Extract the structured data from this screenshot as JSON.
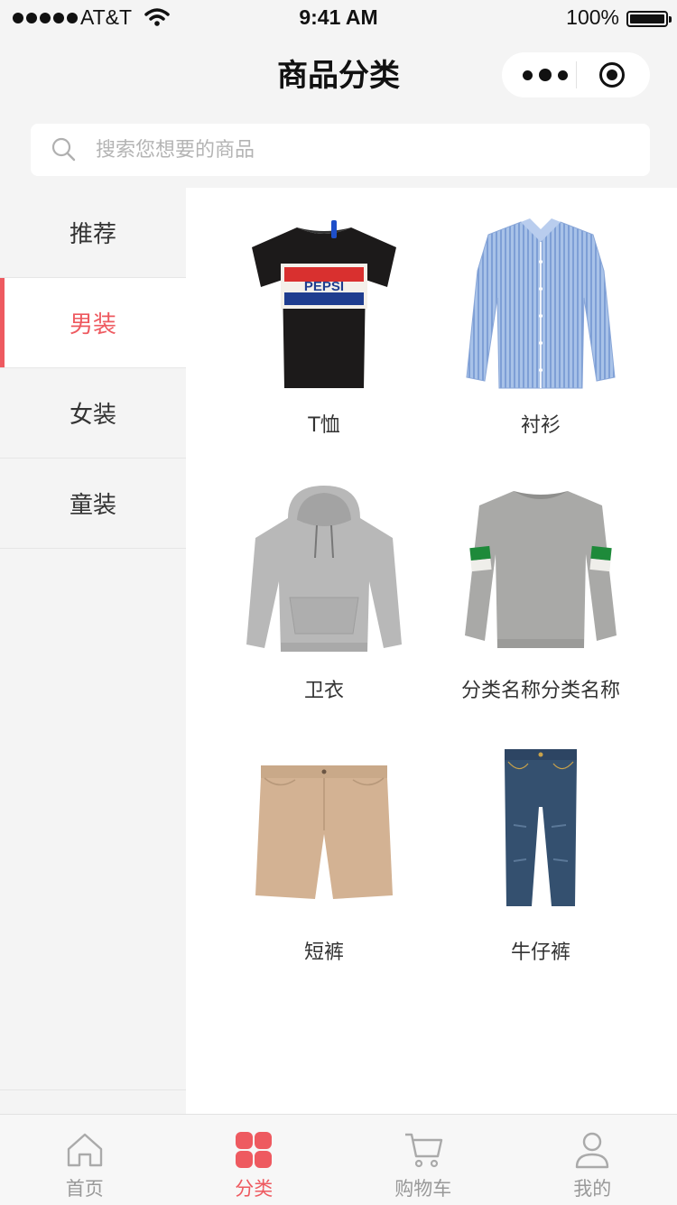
{
  "status_bar": {
    "carrier": "AT&T",
    "time": "9:41 AM",
    "battery": "100%"
  },
  "nav": {
    "title": "商品分类"
  },
  "search": {
    "placeholder": "搜索您想要的商品"
  },
  "sidebar": {
    "items": [
      {
        "label": "推荐",
        "active": false
      },
      {
        "label": "男装",
        "active": true
      },
      {
        "label": "女装",
        "active": false
      },
      {
        "label": "童装",
        "active": false
      }
    ]
  },
  "categories": [
    {
      "label": "T恤",
      "icon": "tshirt-image"
    },
    {
      "label": "衬衫",
      "icon": "shirt-image"
    },
    {
      "label": "卫衣",
      "icon": "hoodie-image"
    },
    {
      "label": "分类名称分类名称",
      "icon": "sweater-image"
    },
    {
      "label": "短裤",
      "icon": "shorts-image"
    },
    {
      "label": "牛仔裤",
      "icon": "jeans-image"
    }
  ],
  "tabbar": {
    "items": [
      {
        "label": "首页",
        "icon": "home-icon",
        "active": false
      },
      {
        "label": "分类",
        "icon": "category-icon",
        "active": true
      },
      {
        "label": "购物车",
        "icon": "cart-icon",
        "active": false
      },
      {
        "label": "我的",
        "icon": "profile-icon",
        "active": false
      }
    ]
  },
  "colors": {
    "accent": "#ee5a60",
    "background": "#f4f4f4"
  }
}
